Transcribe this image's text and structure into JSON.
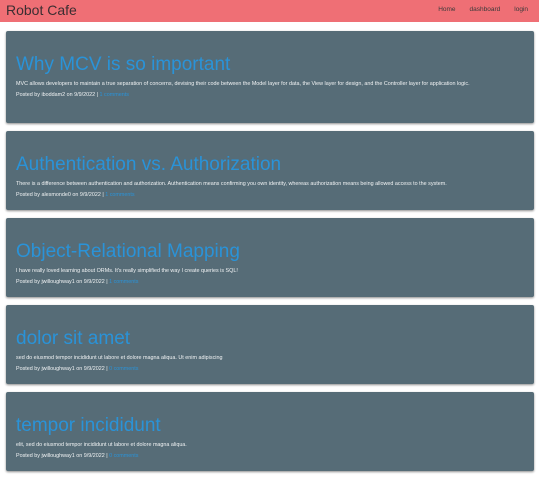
{
  "navbar": {
    "brand": "Robot Cafe",
    "links": [
      "Home",
      "dashboard",
      "login"
    ]
  },
  "posts": [
    {
      "title": "Why MCV is so important",
      "body": "MVC allows developers to maintain a true separation of concerns, devising their code between the Model layer for data, the View layer for design, and the Controller layer for application logic.",
      "meta": "Posted by iboddam2 on 9/9/2022 |",
      "comments": "1 comments"
    },
    {
      "title": "Authentication vs. Authorization",
      "body": "There is a difference between authentication and authorization. Authentication means confirming you own identity, whereas authorization means being allowed access to the system.",
      "meta": "Posted by alesmonde0 on 9/9/2022 |",
      "comments": "1 comments"
    },
    {
      "title": "Object-Relational Mapping",
      "body": "I have really loved learning about ORMs. It's really simplified the way I create queries is SQL!",
      "meta": "Posted by jwilloughway1 on 9/9/2022 |",
      "comments": "1 comments"
    },
    {
      "title": "dolor sit amet",
      "body": "sed do eiusmod tempor incididunt ut labore et dolore magna aliqua. Ut enim adipiscing",
      "meta": "Posted by jwilloughway1 on 9/9/2022 |",
      "comments": "0 comments"
    },
    {
      "title": "tempor incididunt",
      "body": "elit, sed do eiusmod tempor incididunt ut labore et dolore magna aliqua.",
      "meta": "Posted by jwilloughway1 on 9/9/2022 |",
      "comments": "0 comments"
    }
  ]
}
